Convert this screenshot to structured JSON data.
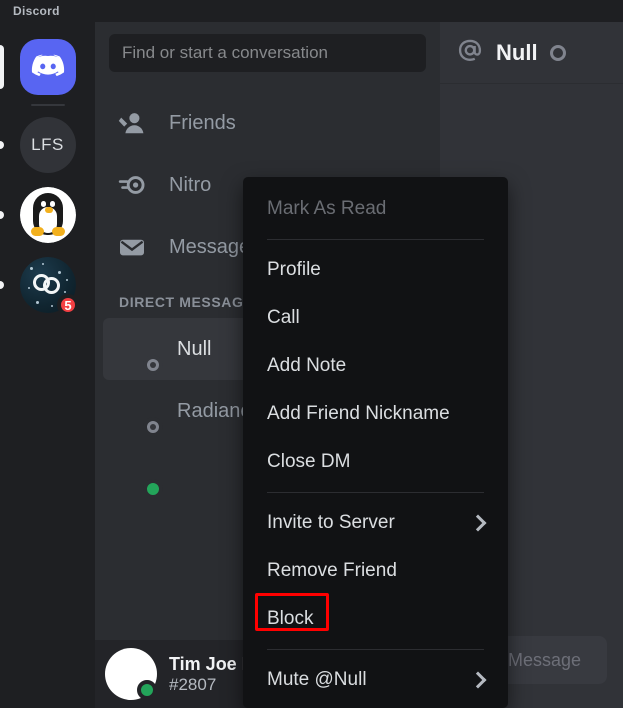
{
  "window": {
    "title": "Discord"
  },
  "server_rail": {
    "items": [
      {
        "name": "Discord Home",
        "type": "home",
        "icon": "discord-logo-icon",
        "unread": false,
        "badge": null,
        "selected": true
      },
      {
        "name": "LFS",
        "type": "text",
        "label": "LFS",
        "icon": "server-initials-icon",
        "unread": true,
        "badge": null,
        "selected": false
      },
      {
        "name": "Linux Server",
        "type": "penguin",
        "icon": "penguin-avatar-icon",
        "unread": true,
        "badge": null,
        "selected": false
      },
      {
        "name": "Space Server",
        "type": "space",
        "icon": "space-server-icon",
        "unread": true,
        "badge": "5",
        "selected": false
      }
    ]
  },
  "search": {
    "placeholder": "Find or start a conversation",
    "value": ""
  },
  "nav": {
    "items": [
      {
        "label": "Friends",
        "icon": "friends-icon"
      },
      {
        "label": "Nitro",
        "icon": "nitro-icon"
      },
      {
        "label": "Message Requests",
        "icon": "message-requests-icon"
      }
    ]
  },
  "direct_messages": {
    "header": "DIRECT MESSAGES",
    "items": [
      {
        "name": "Null",
        "status": "offline",
        "selected": true,
        "avatar": "null-avatar"
      },
      {
        "name": "Radiance",
        "status": "offline",
        "selected": false,
        "avatar": "radiance-avatar"
      },
      {
        "name": "",
        "status": "online",
        "selected": false,
        "avatar": "third-user-avatar"
      }
    ]
  },
  "user_panel": {
    "name": "Tim Joe R",
    "tag": "#2807",
    "status": "online",
    "avatar": "penguin-avatar-icon"
  },
  "chat": {
    "at_symbol": "@",
    "title": "Null",
    "status": "offline",
    "composer_placeholder": "Message"
  },
  "context_menu": {
    "items": [
      {
        "label": "Mark As Read",
        "disabled": true,
        "submenu": false,
        "separator_after": true
      },
      {
        "label": "Profile",
        "disabled": false,
        "submenu": false,
        "separator_after": false
      },
      {
        "label": "Call",
        "disabled": false,
        "submenu": false,
        "separator_after": false
      },
      {
        "label": "Add Note",
        "disabled": false,
        "submenu": false,
        "separator_after": false
      },
      {
        "label": "Add Friend Nickname",
        "disabled": false,
        "submenu": false,
        "separator_after": false
      },
      {
        "label": "Close DM",
        "disabled": false,
        "submenu": false,
        "separator_after": true
      },
      {
        "label": "Invite to Server",
        "disabled": false,
        "submenu": true,
        "separator_after": false
      },
      {
        "label": "Remove Friend",
        "disabled": false,
        "submenu": false,
        "separator_after": false
      },
      {
        "label": "Block",
        "disabled": false,
        "submenu": false,
        "separator_after": true,
        "highlighted": true
      },
      {
        "label": "Mute @Null",
        "disabled": false,
        "submenu": true,
        "separator_after": false
      }
    ]
  },
  "colors": {
    "accent": "#5865f2",
    "badge_red": "#f23f43",
    "online_green": "#23a55a",
    "offline_gray": "#80848e",
    "highlight_red": "#ff0000",
    "rail_bg": "#1e1f22",
    "sidebar_bg": "#2b2d31",
    "chat_bg": "#313338",
    "menu_bg": "#111214"
  }
}
